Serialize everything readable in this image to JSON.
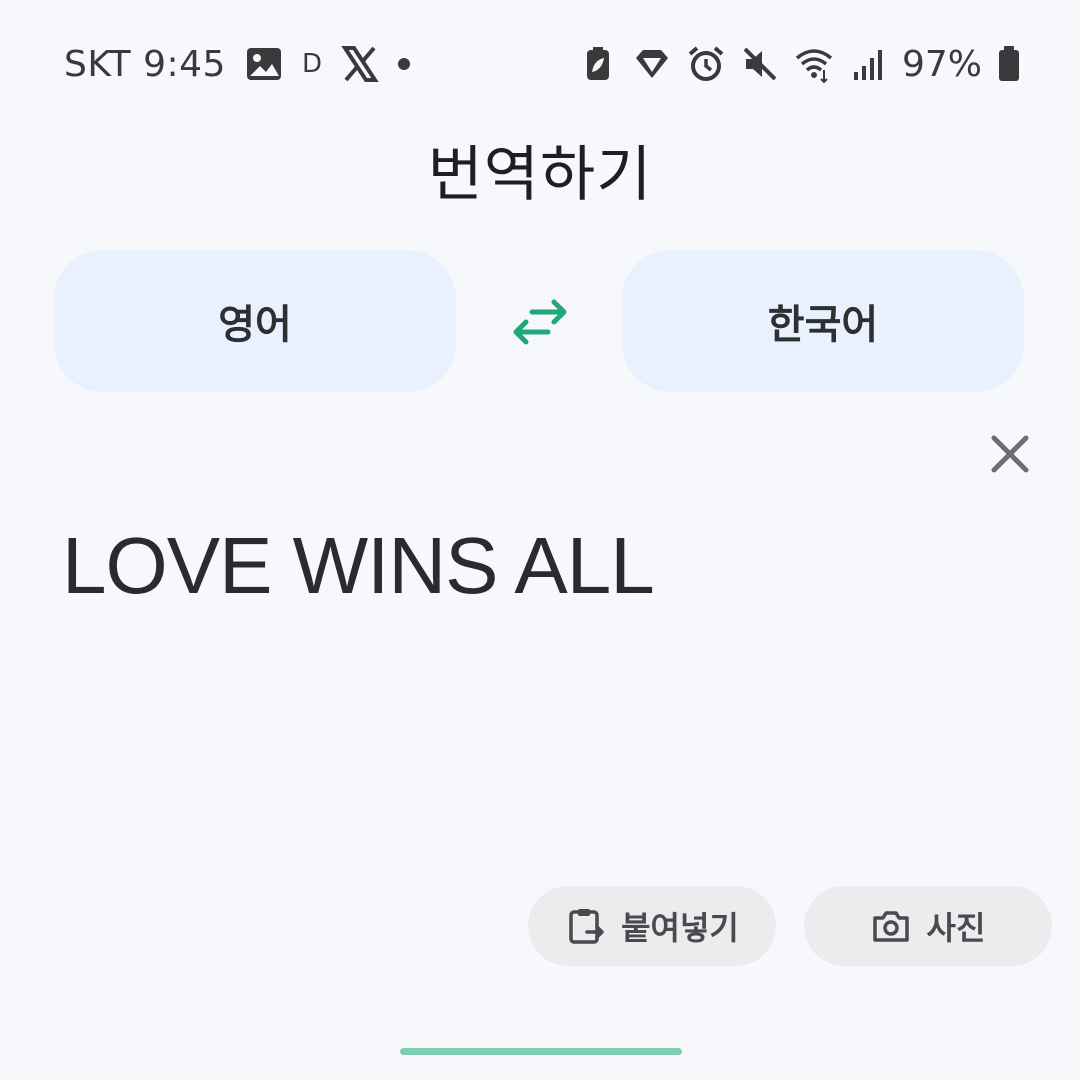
{
  "status_bar": {
    "carrier_time": "SKT 9:45",
    "notif_d": "D",
    "battery_percent": "97%",
    "icons_left": [
      "image-icon",
      "d-app-icon",
      "x-logo-icon",
      "dot-icon"
    ],
    "icons_right": [
      "battery-saver-icon",
      "diamond-icon",
      "alarm-icon",
      "mute-icon",
      "wifi-icon",
      "signal-icon",
      "battery-icon"
    ]
  },
  "header": {
    "title": "번역하기"
  },
  "languages": {
    "source": "영어",
    "target": "한국어",
    "swap_icon": "swap-arrows-icon"
  },
  "input": {
    "text": "LOVE WINS ALL",
    "clear_icon": "close-icon"
  },
  "actions": {
    "paste_label": "붙여넣기",
    "photo_label": "사진"
  },
  "colors": {
    "accent": "#1fa87a",
    "background": "#f6f8fc",
    "language_button": "#e8f1fd",
    "chip": "#ececef",
    "nav_handle": "#7ecfb1"
  }
}
